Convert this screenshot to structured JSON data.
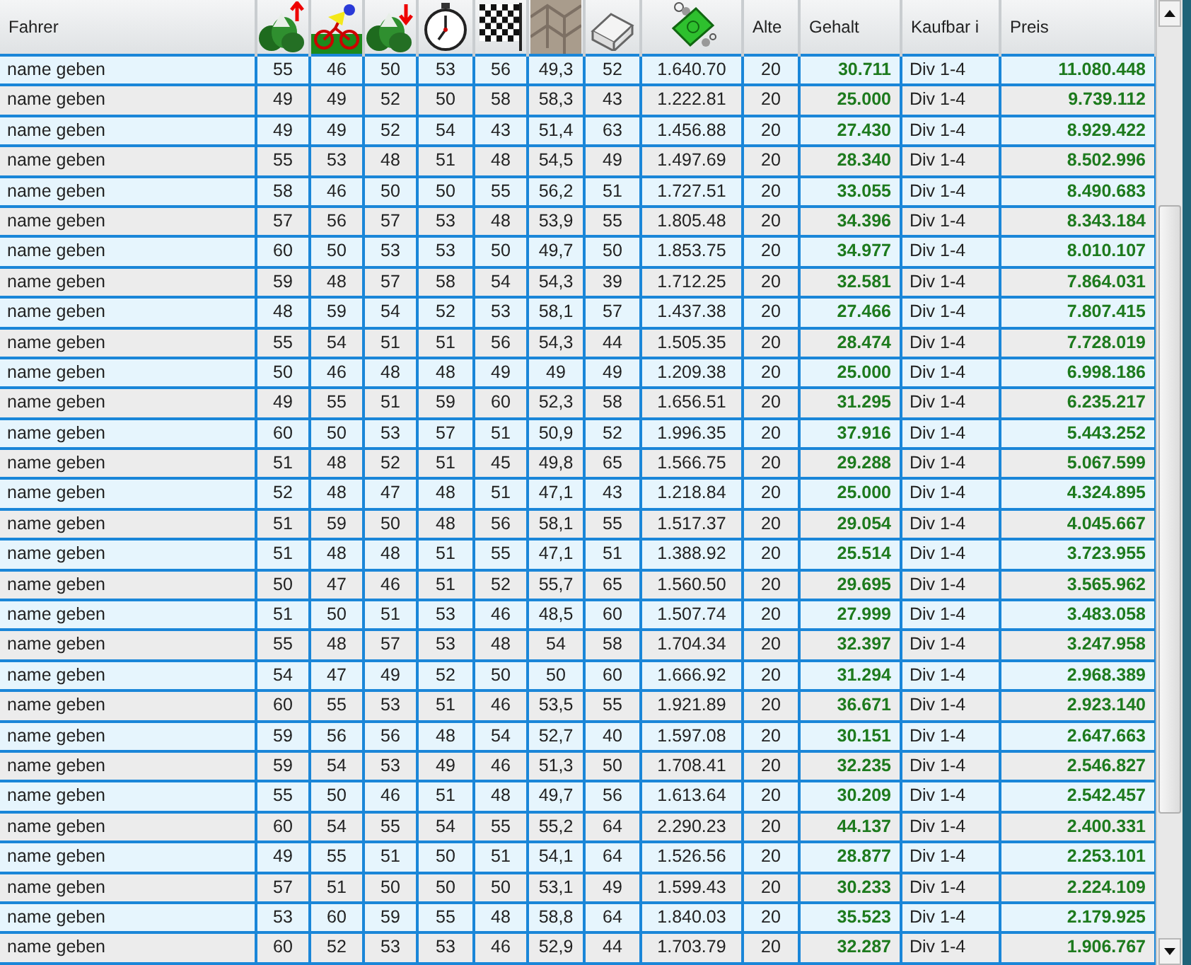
{
  "table": {
    "columns": [
      {
        "kind": "text",
        "label": "Fahrer"
      },
      {
        "kind": "icon"
      },
      {
        "kind": "icon"
      },
      {
        "kind": "icon"
      },
      {
        "kind": "icon"
      },
      {
        "kind": "icon"
      },
      {
        "kind": "icon"
      },
      {
        "kind": "icon"
      },
      {
        "kind": "icon"
      },
      {
        "kind": "text",
        "label": "Alte"
      },
      {
        "kind": "text",
        "label": "Gehalt"
      },
      {
        "kind": "text",
        "label": "Kaufbar i"
      },
      {
        "kind": "text",
        "label": "Preis"
      }
    ],
    "rows": [
      {
        "cells": [
          "name geben",
          "55",
          "46",
          "50",
          "53",
          "56",
          "49,3",
          "52",
          "1.640.70",
          "20",
          "30.711",
          "Div 1-4",
          "11.080.448"
        ]
      },
      {
        "cells": [
          "name geben",
          "49",
          "49",
          "52",
          "50",
          "58",
          "58,3",
          "43",
          "1.222.81",
          "20",
          "25.000",
          "Div 1-4",
          "9.739.112"
        ]
      },
      {
        "cells": [
          "name geben",
          "49",
          "49",
          "52",
          "54",
          "43",
          "51,4",
          "63",
          "1.456.88",
          "20",
          "27.430",
          "Div 1-4",
          "8.929.422"
        ]
      },
      {
        "cells": [
          "name geben",
          "55",
          "53",
          "48",
          "51",
          "48",
          "54,5",
          "49",
          "1.497.69",
          "20",
          "28.340",
          "Div 1-4",
          "8.502.996"
        ]
      },
      {
        "cells": [
          "name geben",
          "58",
          "46",
          "50",
          "50",
          "55",
          "56,2",
          "51",
          "1.727.51",
          "20",
          "33.055",
          "Div 1-4",
          "8.490.683"
        ]
      },
      {
        "cells": [
          "name geben",
          "57",
          "56",
          "57",
          "53",
          "48",
          "53,9",
          "55",
          "1.805.48",
          "20",
          "34.396",
          "Div 1-4",
          "8.343.184"
        ]
      },
      {
        "cells": [
          "name geben",
          "60",
          "50",
          "53",
          "53",
          "50",
          "49,7",
          "50",
          "1.853.75",
          "20",
          "34.977",
          "Div 1-4",
          "8.010.107"
        ]
      },
      {
        "cells": [
          "name geben",
          "59",
          "48",
          "57",
          "58",
          "54",
          "54,3",
          "39",
          "1.712.25",
          "20",
          "32.581",
          "Div 1-4",
          "7.864.031"
        ]
      },
      {
        "cells": [
          "name geben",
          "48",
          "59",
          "54",
          "52",
          "53",
          "58,1",
          "57",
          "1.437.38",
          "20",
          "27.466",
          "Div 1-4",
          "7.807.415"
        ]
      },
      {
        "cells": [
          "name geben",
          "55",
          "54",
          "51",
          "51",
          "56",
          "54,3",
          "44",
          "1.505.35",
          "20",
          "28.474",
          "Div 1-4",
          "7.728.019"
        ]
      },
      {
        "cells": [
          "name geben",
          "50",
          "46",
          "48",
          "48",
          "49",
          "49",
          "49",
          "1.209.38",
          "20",
          "25.000",
          "Div 1-4",
          "6.998.186"
        ]
      },
      {
        "cells": [
          "name geben",
          "49",
          "55",
          "51",
          "59",
          "60",
          "52,3",
          "58",
          "1.656.51",
          "20",
          "31.295",
          "Div 1-4",
          "6.235.217"
        ]
      },
      {
        "cells": [
          "name geben",
          "60",
          "50",
          "53",
          "57",
          "51",
          "50,9",
          "52",
          "1.996.35",
          "20",
          "37.916",
          "Div 1-4",
          "5.443.252"
        ]
      },
      {
        "cells": [
          "name geben",
          "51",
          "48",
          "52",
          "51",
          "45",
          "49,8",
          "65",
          "1.566.75",
          "20",
          "29.288",
          "Div 1-4",
          "5.067.599"
        ]
      },
      {
        "cells": [
          "name geben",
          "52",
          "48",
          "47",
          "48",
          "51",
          "47,1",
          "43",
          "1.218.84",
          "20",
          "25.000",
          "Div 1-4",
          "4.324.895"
        ]
      },
      {
        "cells": [
          "name geben",
          "51",
          "59",
          "50",
          "48",
          "56",
          "58,1",
          "55",
          "1.517.37",
          "20",
          "29.054",
          "Div 1-4",
          "4.045.667"
        ]
      },
      {
        "cells": [
          "name geben",
          "51",
          "48",
          "48",
          "51",
          "55",
          "47,1",
          "51",
          "1.388.92",
          "20",
          "25.514",
          "Div 1-4",
          "3.723.955"
        ]
      },
      {
        "cells": [
          "name geben",
          "50",
          "47",
          "46",
          "51",
          "52",
          "55,7",
          "65",
          "1.560.50",
          "20",
          "29.695",
          "Div 1-4",
          "3.565.962"
        ]
      },
      {
        "cells": [
          "name geben",
          "51",
          "50",
          "51",
          "53",
          "46",
          "48,5",
          "60",
          "1.507.74",
          "20",
          "27.999",
          "Div 1-4",
          "3.483.058"
        ]
      },
      {
        "cells": [
          "name geben",
          "55",
          "48",
          "57",
          "53",
          "48",
          "54",
          "58",
          "1.704.34",
          "20",
          "32.397",
          "Div 1-4",
          "3.247.958"
        ]
      },
      {
        "cells": [
          "name geben",
          "54",
          "47",
          "49",
          "52",
          "50",
          "50",
          "60",
          "1.666.92",
          "20",
          "31.294",
          "Div 1-4",
          "2.968.389"
        ]
      },
      {
        "cells": [
          "name geben",
          "60",
          "55",
          "53",
          "51",
          "46",
          "53,5",
          "55",
          "1.921.89",
          "20",
          "36.671",
          "Div 1-4",
          "2.923.140"
        ]
      },
      {
        "cells": [
          "name geben",
          "59",
          "56",
          "56",
          "48",
          "54",
          "52,7",
          "40",
          "1.597.08",
          "20",
          "30.151",
          "Div 1-4",
          "2.647.663"
        ]
      },
      {
        "cells": [
          "name geben",
          "59",
          "54",
          "53",
          "49",
          "46",
          "51,3",
          "50",
          "1.708.41",
          "20",
          "32.235",
          "Div 1-4",
          "2.546.827"
        ]
      },
      {
        "cells": [
          "name geben",
          "55",
          "50",
          "46",
          "51",
          "48",
          "49,7",
          "56",
          "1.613.64",
          "20",
          "30.209",
          "Div 1-4",
          "2.542.457"
        ]
      },
      {
        "cells": [
          "name geben",
          "60",
          "54",
          "55",
          "54",
          "55",
          "55,2",
          "64",
          "2.290.23",
          "20",
          "44.137",
          "Div 1-4",
          "2.400.331"
        ]
      },
      {
        "cells": [
          "name geben",
          "49",
          "55",
          "51",
          "50",
          "51",
          "54,1",
          "64",
          "1.526.56",
          "20",
          "28.877",
          "Div 1-4",
          "2.253.101"
        ]
      },
      {
        "cells": [
          "name geben",
          "57",
          "51",
          "50",
          "50",
          "50",
          "53,1",
          "49",
          "1.599.43",
          "20",
          "30.233",
          "Div 1-4",
          "2.224.109"
        ]
      },
      {
        "cells": [
          "name geben",
          "53",
          "60",
          "59",
          "55",
          "48",
          "58,8",
          "64",
          "1.840.03",
          "20",
          "35.523",
          "Div 1-4",
          "2.179.925"
        ]
      },
      {
        "cells": [
          "name geben",
          "60",
          "52",
          "53",
          "53",
          "46",
          "52,9",
          "44",
          "1.703.79",
          "20",
          "32.287",
          "Div 1-4",
          "1.906.767"
        ]
      }
    ]
  }
}
